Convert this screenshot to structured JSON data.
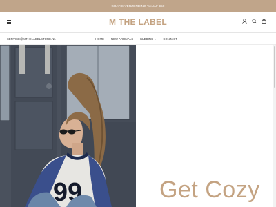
{
  "announcement": {
    "text": "GRATIS VERZENDING VANAF €50"
  },
  "header": {
    "logo": "M THE LABEL",
    "icons": [
      "menu-icon",
      "account-icon",
      "search-icon",
      "bag-icon"
    ]
  },
  "contact": {
    "email": "SERVICE@MTHELABELSTORE.NL"
  },
  "nav": {
    "home": "HOME",
    "new_arrivals": "NEW ARRIVALS",
    "kleding": "KLEDING",
    "contact": "CONTACT"
  },
  "hero": {
    "sweater_number": "99",
    "promo_title": "Get Cozy"
  },
  "colors": {
    "announcement_bg": "#c0a58a",
    "brand": "#c4a382"
  }
}
